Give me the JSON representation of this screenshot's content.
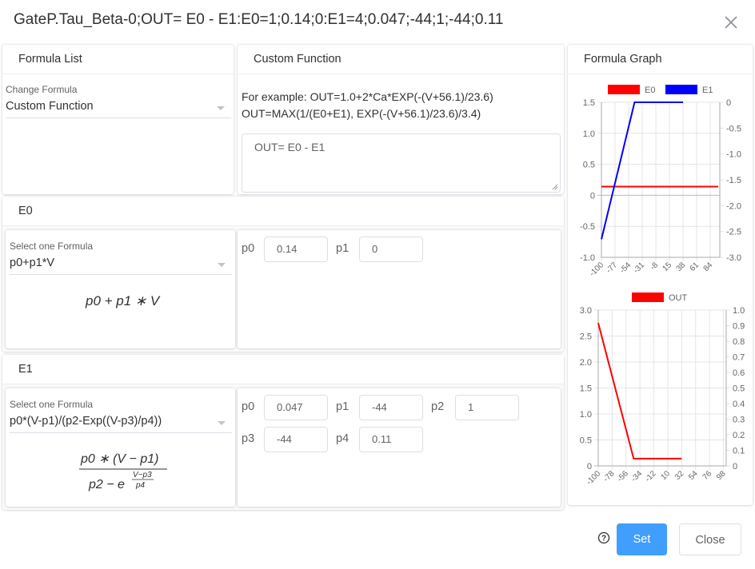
{
  "dialog": {
    "title": "GateP.Tau_Beta-0;OUT= E0 - E1:E0=1;0.14;0:E1=4;0.047;-44;1;-44;0.11",
    "close_icon": "close-icon",
    "help_icon": "question-circle-icon",
    "set_label": "Set",
    "close_label": "Close"
  },
  "formula_list": {
    "header": "Formula List",
    "select_label": "Change Formula",
    "selected": "Custom Function"
  },
  "custom_function": {
    "header": "Custom Function",
    "example_line1": "For example: OUT=1.0+2*Ca*EXP(-(V+56.1)/23.6)",
    "example_line2": "OUT=MAX(1/(E0+E1), EXP(-(V+56.1)/23.6)/3.4)",
    "value": "OUT= E0 - E1"
  },
  "e0": {
    "header": "E0",
    "select_label": "Select one Formula",
    "selected": "p0+p1*V",
    "params": [
      {
        "name": "p0",
        "value": "0.14"
      },
      {
        "name": "p1",
        "value": "0"
      }
    ]
  },
  "e1": {
    "header": "E1",
    "select_label": "Select one Formula",
    "selected": "p0*(V-p1)/(p2-Exp((V-p3)/p4))",
    "params": [
      {
        "name": "p0",
        "value": "0.047"
      },
      {
        "name": "p1",
        "value": "-44"
      },
      {
        "name": "p2",
        "value": "1"
      },
      {
        "name": "p3",
        "value": "-44"
      },
      {
        "name": "p4",
        "value": "0.11"
      }
    ]
  },
  "graph": {
    "header": "Formula Graph",
    "colors": {
      "e0": "#ff0000",
      "e1": "#0000ff",
      "out": "#ff0000",
      "grid": "#e5e5e5",
      "axis": "#888888"
    }
  },
  "chart_data": [
    {
      "type": "line",
      "title": "",
      "legend": [
        "E0",
        "E1"
      ],
      "legend_position": "top",
      "x": [
        -100,
        -77,
        -54,
        -31,
        -8,
        15,
        38,
        61,
        84
      ],
      "x_ticks": [
        "-100",
        "-77",
        "-54",
        "-31",
        "-8",
        "15",
        "38",
        "61",
        "84"
      ],
      "y_left_ticks": [
        "1.5",
        "1.0",
        "0.5",
        "0",
        "-0.5",
        "-1.0"
      ],
      "y_right_ticks": [
        "0",
        "-0.5",
        "-1.0",
        "-1.5",
        "-2.0",
        "-2.5",
        "-3.0"
      ],
      "ylim_left": [
        -1.0,
        1.5
      ],
      "ylim_right": [
        -3.0,
        0
      ],
      "grid": true,
      "series": [
        {
          "name": "E0",
          "axis": "left",
          "x": [
            -100,
            100
          ],
          "y": [
            0.14,
            0.14
          ]
        },
        {
          "name": "E1",
          "axis": "right",
          "x": [
            -100,
            -44,
            38
          ],
          "y": [
            -2.65,
            0,
            0
          ]
        }
      ]
    },
    {
      "type": "line",
      "title": "",
      "legend": [
        "OUT"
      ],
      "legend_position": "top",
      "x_ticks": [
        "-100",
        "-78",
        "-56",
        "-34",
        "-12",
        "10",
        "32",
        "54",
        "76",
        "98"
      ],
      "y_left_ticks": [
        "3.0",
        "2.5",
        "2.0",
        "1.5",
        "1.0",
        "0.5",
        "0"
      ],
      "y_right_ticks": [
        "1.0",
        "0.9",
        "0.8",
        "0.7",
        "0.6",
        "0.5",
        "0.4",
        "0.3",
        "0.2",
        "0.1",
        "0"
      ],
      "ylim_left": [
        0,
        3.0
      ],
      "ylim_right": [
        0,
        1.0
      ],
      "grid": true,
      "series": [
        {
          "name": "OUT",
          "axis": "left",
          "x": [
            -100,
            -44,
            32
          ],
          "y": [
            2.75,
            0.14,
            0.14
          ]
        }
      ]
    }
  ]
}
